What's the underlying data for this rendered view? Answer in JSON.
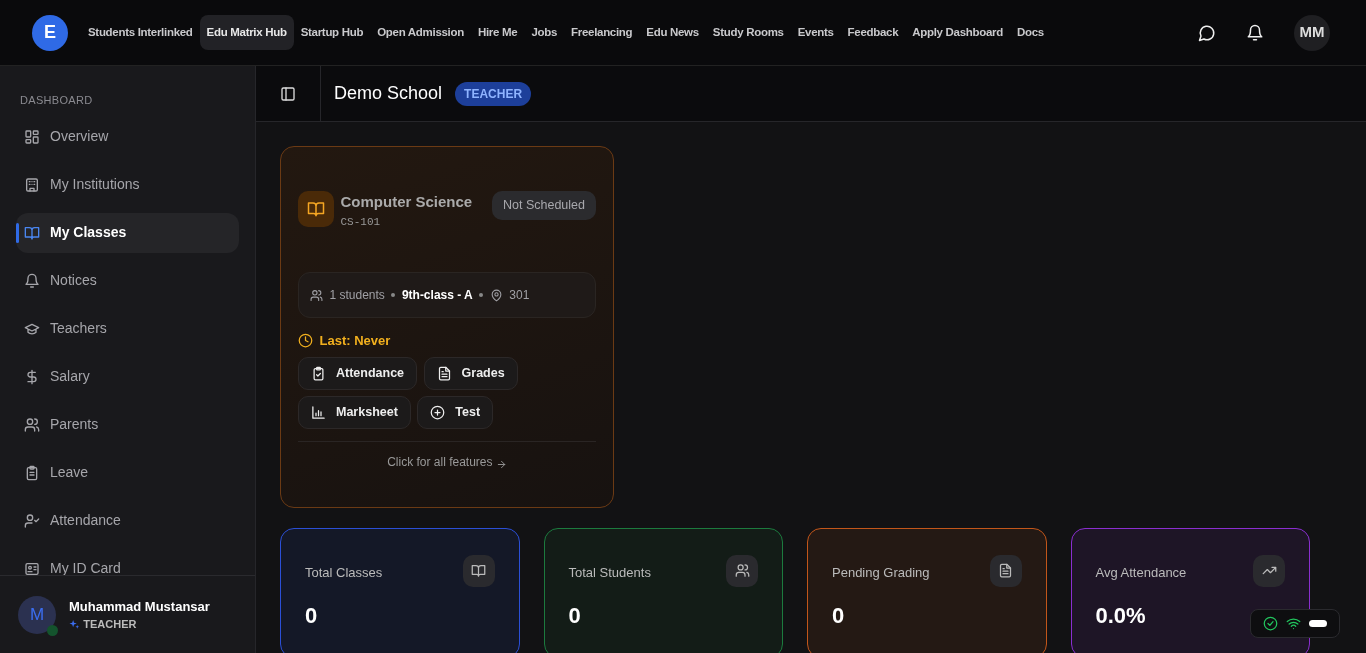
{
  "topnav": {
    "logo_letter": "E",
    "links": [
      {
        "label": "Students Interlinked",
        "selected": false
      },
      {
        "label": "Edu Matrix Hub",
        "selected": true
      },
      {
        "label": "Startup Hub",
        "selected": false
      },
      {
        "label": "Open Admission",
        "selected": false
      },
      {
        "label": "Hire Me",
        "selected": false
      },
      {
        "label": "Jobs",
        "selected": false
      },
      {
        "label": "Freelancing",
        "selected": false
      },
      {
        "label": "Edu News",
        "selected": false
      },
      {
        "label": "Study Rooms",
        "selected": false
      },
      {
        "label": "Events",
        "selected": false
      },
      {
        "label": "Feedback",
        "selected": false
      },
      {
        "label": "Apply Dashboard",
        "selected": false
      },
      {
        "label": "Docs",
        "selected": false
      }
    ],
    "avatar": "MM"
  },
  "sidebar": {
    "section": "DASHBOARD",
    "items": [
      {
        "label": "Overview",
        "selected": false
      },
      {
        "label": "My Institutions",
        "selected": false
      },
      {
        "label": "My Classes",
        "selected": true
      },
      {
        "label": "Notices",
        "selected": false
      },
      {
        "label": "Teachers",
        "selected": false
      },
      {
        "label": "Salary",
        "selected": false
      },
      {
        "label": "Parents",
        "selected": false
      },
      {
        "label": "Leave",
        "selected": false
      },
      {
        "label": "Attendance",
        "selected": false
      },
      {
        "label": "My ID Card",
        "selected": false
      }
    ],
    "user": {
      "initial": "M",
      "name": "Muhammad Mustansar",
      "role": "TEACHER",
      "online": true
    }
  },
  "header": {
    "title": "Demo School",
    "badge": "TEACHER"
  },
  "class_card": {
    "name": "Computer Science",
    "code": "CS-101",
    "status": "Not Scheduled",
    "students": "1 students",
    "section": "9th-class - A",
    "room": "301",
    "last": "Last: Never",
    "actions": [
      {
        "label": "Attendance"
      },
      {
        "label": "Grades"
      },
      {
        "label": "Marksheet"
      },
      {
        "label": "Test"
      }
    ],
    "footer": "Click for all features"
  },
  "stats": [
    {
      "label": "Total Classes",
      "value": "0",
      "color": "#2b4fd6"
    },
    {
      "label": "Total Students",
      "value": "0",
      "color": "#1c7a3e"
    },
    {
      "label": "Pending Grading",
      "value": "0",
      "color": "#c2561a"
    },
    {
      "label": "Avg Attendance",
      "value": "0.0%",
      "color": "#8a2ed0"
    }
  ]
}
